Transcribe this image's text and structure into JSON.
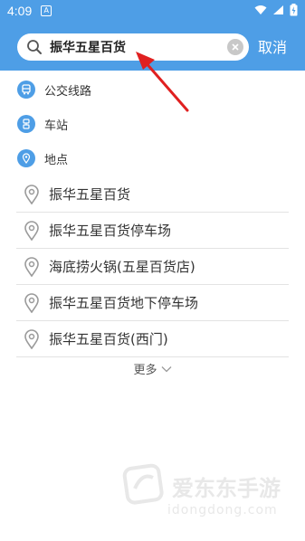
{
  "status_bar": {
    "time": "4:09",
    "notification_icon": "A"
  },
  "search": {
    "query": "振华五星百货",
    "cancel_label": "取消"
  },
  "categories": [
    {
      "label": "公交线路",
      "icon": "bus-icon"
    },
    {
      "label": "车站",
      "icon": "station-icon"
    },
    {
      "label": "地点",
      "icon": "location-icon"
    }
  ],
  "results": [
    {
      "label": "振华五星百货"
    },
    {
      "label": "振华五星百货停车场"
    },
    {
      "label": "海底捞火锅(五星百货店)"
    },
    {
      "label": "振华五星百货地下停车场"
    },
    {
      "label": "振华五星百货(西门)"
    }
  ],
  "more_label": "更多",
  "watermark": {
    "title": "爱东东手游",
    "url": "idongdong.com"
  },
  "colors": {
    "accent": "#4e9ee6",
    "annotation_arrow": "#e02020"
  }
}
